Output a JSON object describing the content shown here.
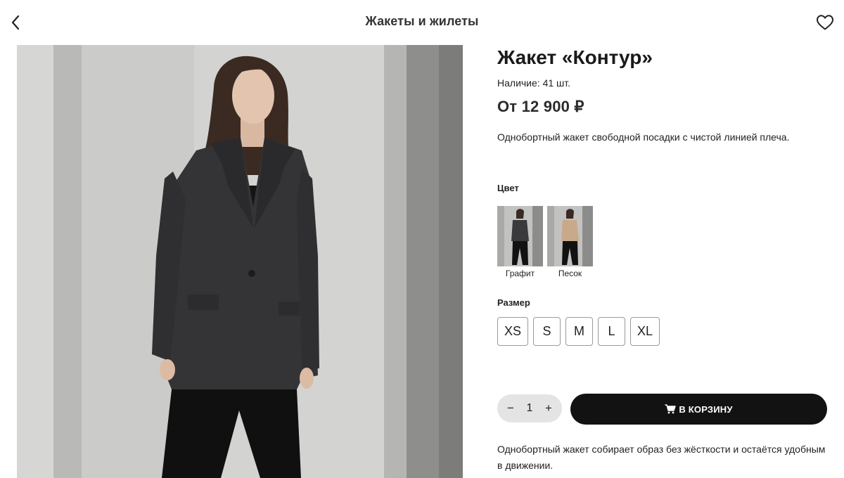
{
  "header": {
    "title": "Жакеты и жилеты",
    "back_icon": "chevron-left-icon",
    "favorite_icon": "heart-icon"
  },
  "product": {
    "title": "Жакет «Контур»",
    "stock": "Наличие: 41 шт.",
    "price": "От 12 900 ₽",
    "short_description": "Однобортный жакет свободной посадки с чистой линией плеча.",
    "long_description": "Однобортный жакет собирает образ без жёсткости и остаётся удобным в движении."
  },
  "color": {
    "label": "Цвет",
    "options": [
      {
        "name": "Графит",
        "jacket_color": "#3a3a3c"
      },
      {
        "name": "Песок",
        "jacket_color": "#c8a98a"
      }
    ]
  },
  "size": {
    "label": "Размер",
    "options": [
      "XS",
      "S",
      "M",
      "L",
      "XL"
    ]
  },
  "quantity": {
    "minus": "−",
    "value": "1",
    "plus": "+"
  },
  "cart": {
    "icon": "cart-icon",
    "label": "В КОРЗИНУ"
  },
  "colors": {
    "primary_button": "#121212",
    "quantity_bg": "#e4e4e4",
    "size_border": "#9a9a9a"
  }
}
